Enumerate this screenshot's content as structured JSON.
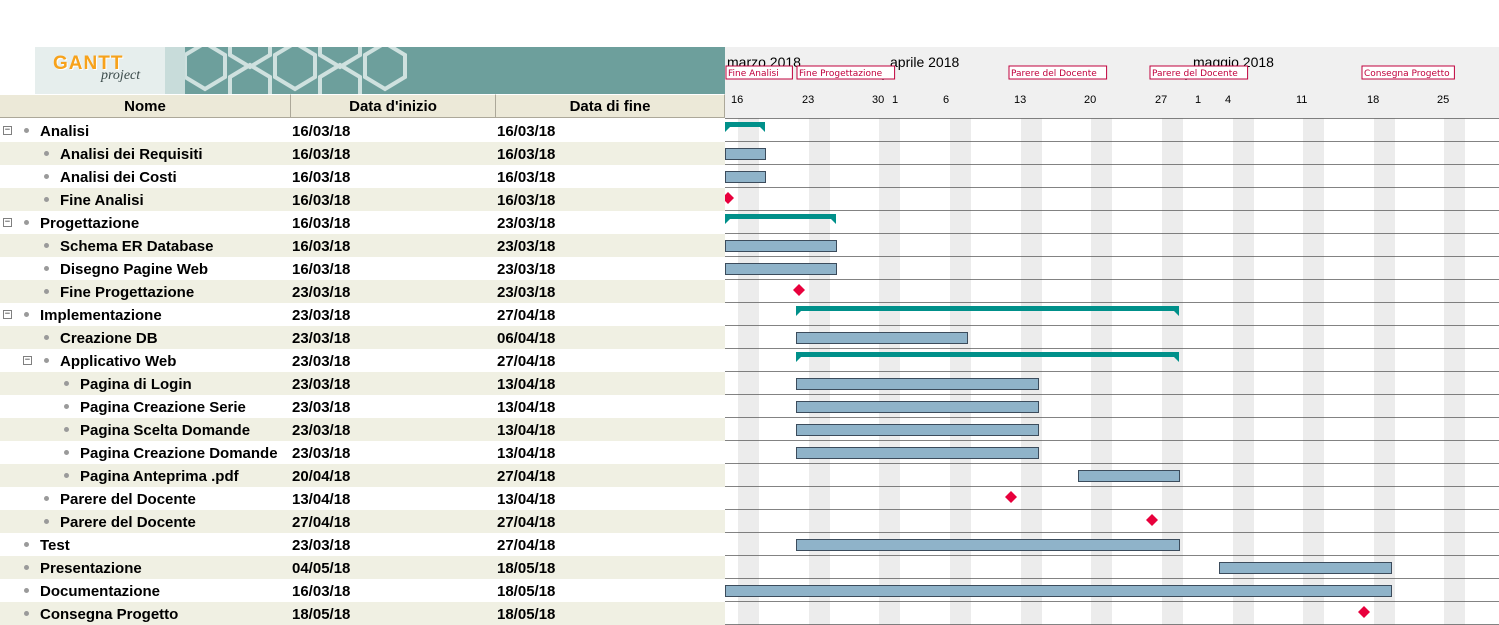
{
  "banner": {
    "logo_main": "GANTT",
    "logo_sub": "project"
  },
  "columns": {
    "name": "Nome",
    "start": "Data d'inizio",
    "end": "Data di fine"
  },
  "timeline": {
    "months": [
      {
        "label": "marzo 2018",
        "date": "2018-03-01"
      },
      {
        "label": "aprile 2018",
        "date": "2018-04-01"
      },
      {
        "label": "maggio 2018",
        "date": "2018-05-01"
      }
    ],
    "day_ticks": [
      {
        "label": "16",
        "date": "2018-03-16"
      },
      {
        "label": "23",
        "date": "2018-03-23"
      },
      {
        "label": "30",
        "date": "2018-03-30"
      },
      {
        "label": "1",
        "date": "2018-04-01"
      },
      {
        "label": "6",
        "date": "2018-04-06"
      },
      {
        "label": "13",
        "date": "2018-04-13"
      },
      {
        "label": "20",
        "date": "2018-04-20"
      },
      {
        "label": "27",
        "date": "2018-04-27"
      },
      {
        "label": "1",
        "date": "2018-05-01"
      },
      {
        "label": "4",
        "date": "2018-05-04"
      },
      {
        "label": "11",
        "date": "2018-05-11"
      },
      {
        "label": "18",
        "date": "2018-05-18"
      },
      {
        "label": "25",
        "date": "2018-05-25"
      }
    ],
    "milestone_flags": [
      {
        "label": "Fine Analisi",
        "date": "2018-03-16"
      },
      {
        "label": "Fine Progettazione",
        "date": "2018-03-23"
      },
      {
        "label": "Parere del Docente",
        "date": "2018-04-13"
      },
      {
        "label": "Parere del Docente",
        "date": "2018-04-27"
      },
      {
        "label": "Consegna Progetto",
        "date": "2018-05-18"
      }
    ]
  },
  "tasks": [
    {
      "name": "Analisi",
      "start": "16/03/18",
      "end": "16/03/18",
      "level": 0,
      "kind": "summary",
      "expander": "⊟",
      "s": "2018-03-16",
      "e": "2018-03-20"
    },
    {
      "name": "Analisi dei Requisiti",
      "start": "16/03/18",
      "end": "16/03/18",
      "level": 1,
      "kind": "task",
      "expander": "",
      "s": "2018-03-16",
      "e": "2018-03-20"
    },
    {
      "name": "Analisi dei Costi",
      "start": "16/03/18",
      "end": "16/03/18",
      "level": 1,
      "kind": "task",
      "expander": "",
      "s": "2018-03-16",
      "e": "2018-03-20"
    },
    {
      "name": "Fine Analisi",
      "start": "16/03/18",
      "end": "16/03/18",
      "level": 1,
      "kind": "milestone",
      "expander": "",
      "s": "2018-03-16",
      "e": "2018-03-16"
    },
    {
      "name": "Progettazione",
      "start": "16/03/18",
      "end": "23/03/18",
      "level": 0,
      "kind": "summary",
      "expander": "⊟",
      "s": "2018-03-16",
      "e": "2018-03-27"
    },
    {
      "name": "Schema ER Database",
      "start": "16/03/18",
      "end": "23/03/18",
      "level": 1,
      "kind": "task",
      "expander": "",
      "s": "2018-03-16",
      "e": "2018-03-27"
    },
    {
      "name": "Disegno Pagine Web",
      "start": "16/03/18",
      "end": "23/03/18",
      "level": 1,
      "kind": "task",
      "expander": "",
      "s": "2018-03-16",
      "e": "2018-03-27"
    },
    {
      "name": "Fine Progettazione",
      "start": "23/03/18",
      "end": "23/03/18",
      "level": 1,
      "kind": "milestone",
      "expander": "",
      "s": "2018-03-23",
      "e": "2018-03-23"
    },
    {
      "name": "Implementazione",
      "start": "23/03/18",
      "end": "27/04/18",
      "level": 0,
      "kind": "summary",
      "expander": "⊟",
      "s": "2018-03-23",
      "e": "2018-04-30"
    },
    {
      "name": "Creazione DB",
      "start": "23/03/18",
      "end": "06/04/18",
      "level": 1,
      "kind": "task",
      "expander": "",
      "s": "2018-03-23",
      "e": "2018-04-09"
    },
    {
      "name": "Applicativo Web",
      "start": "23/03/18",
      "end": "27/04/18",
      "level": 1,
      "kind": "summary",
      "expander": "⊟",
      "s": "2018-03-23",
      "e": "2018-04-30"
    },
    {
      "name": "Pagina di Login",
      "start": "23/03/18",
      "end": "13/04/18",
      "level": 2,
      "kind": "task",
      "expander": "",
      "s": "2018-03-23",
      "e": "2018-04-16"
    },
    {
      "name": "Pagina Creazione Serie",
      "start": "23/03/18",
      "end": "13/04/18",
      "level": 2,
      "kind": "task",
      "expander": "",
      "s": "2018-03-23",
      "e": "2018-04-16"
    },
    {
      "name": "Pagina Scelta Domande",
      "start": "23/03/18",
      "end": "13/04/18",
      "level": 2,
      "kind": "task",
      "expander": "",
      "s": "2018-03-23",
      "e": "2018-04-16"
    },
    {
      "name": "Pagina Creazione Domande",
      "start": "23/03/18",
      "end": "13/04/18",
      "level": 2,
      "kind": "task",
      "expander": "",
      "s": "2018-03-23",
      "e": "2018-04-16"
    },
    {
      "name": "Pagina Anteprima .pdf",
      "start": "20/04/18",
      "end": "27/04/18",
      "level": 2,
      "kind": "task",
      "expander": "",
      "s": "2018-04-20",
      "e": "2018-04-30"
    },
    {
      "name": "Parere del Docente",
      "start": "13/04/18",
      "end": "13/04/18",
      "level": 1,
      "kind": "milestone",
      "expander": "",
      "s": "2018-04-13",
      "e": "2018-04-13"
    },
    {
      "name": "Parere del Docente",
      "start": "27/04/18",
      "end": "27/04/18",
      "level": 1,
      "kind": "milestone",
      "expander": "",
      "s": "2018-04-27",
      "e": "2018-04-27"
    },
    {
      "name": "Test",
      "start": "23/03/18",
      "end": "27/04/18",
      "level": 0,
      "kind": "task",
      "expander": "",
      "s": "2018-03-23",
      "e": "2018-04-30"
    },
    {
      "name": "Presentazione",
      "start": "04/05/18",
      "end": "18/05/18",
      "level": 0,
      "kind": "task",
      "expander": "",
      "s": "2018-05-04",
      "e": "2018-05-21"
    },
    {
      "name": "Documentazione",
      "start": "16/03/18",
      "end": "18/05/18",
      "level": 0,
      "kind": "task",
      "expander": "",
      "s": "2018-03-16",
      "e": "2018-05-21"
    },
    {
      "name": "Consegna Progetto",
      "start": "18/05/18",
      "end": "18/05/18",
      "level": 0,
      "kind": "milestone",
      "expander": "",
      "s": "2018-05-18",
      "e": "2018-05-18"
    }
  ],
  "colors": {
    "task_bar": "#8fb3c9",
    "task_border": "#3c4c5c",
    "summary_bar": "#00908a",
    "milestone": "#e8003c",
    "weekend": "#ececec",
    "flag_border": "#c0003c",
    "alt_row": "#f0f0e3"
  }
}
